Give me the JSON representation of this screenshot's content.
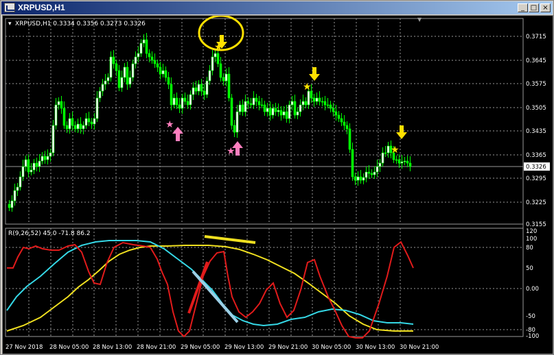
{
  "window": {
    "title": "XRPUSD,H1",
    "buttons": {
      "minimize": "_",
      "maximize": "□",
      "close": "×"
    }
  },
  "main_chart": {
    "header": "XRPUSD,H1  0.3334 0.3356 0.3273 0.3326",
    "price_ticks": [
      "0.3715",
      "0.3645",
      "0.3575",
      "0.3505",
      "0.3435",
      "0.3365",
      "0.3295",
      "0.3225",
      "0.3155"
    ],
    "current_price": "0.3326"
  },
  "indicator": {
    "header": "R(9,26,52) 45.0 -71.8 86.2",
    "ticks": [
      "120",
      "100",
      "80",
      "50",
      "0.00",
      "-50",
      "-80",
      "-100"
    ]
  },
  "time_axis": [
    "27 Nov 2018",
    "28 Nov 05:00",
    "28 Nov 13:00",
    "28 Nov 21:00",
    "29 Nov 05:00",
    "29 Nov 13:00",
    "29 Nov 21:00",
    "30 Nov 05:00",
    "30 Nov 13:00",
    "30 Nov 21:00"
  ],
  "colors": {
    "background": "#000000",
    "grid": "#9a9a9a",
    "candle_bull": "#ffffff",
    "candle_bear": "#00ff00",
    "red_line": "#e21b1b",
    "cyan_line": "#35d8e6",
    "yellow_line": "#f0e020",
    "arrow_down": "#ffe000",
    "arrow_up": "#ff7fbf",
    "annotation_circle": "#ffe000"
  }
}
